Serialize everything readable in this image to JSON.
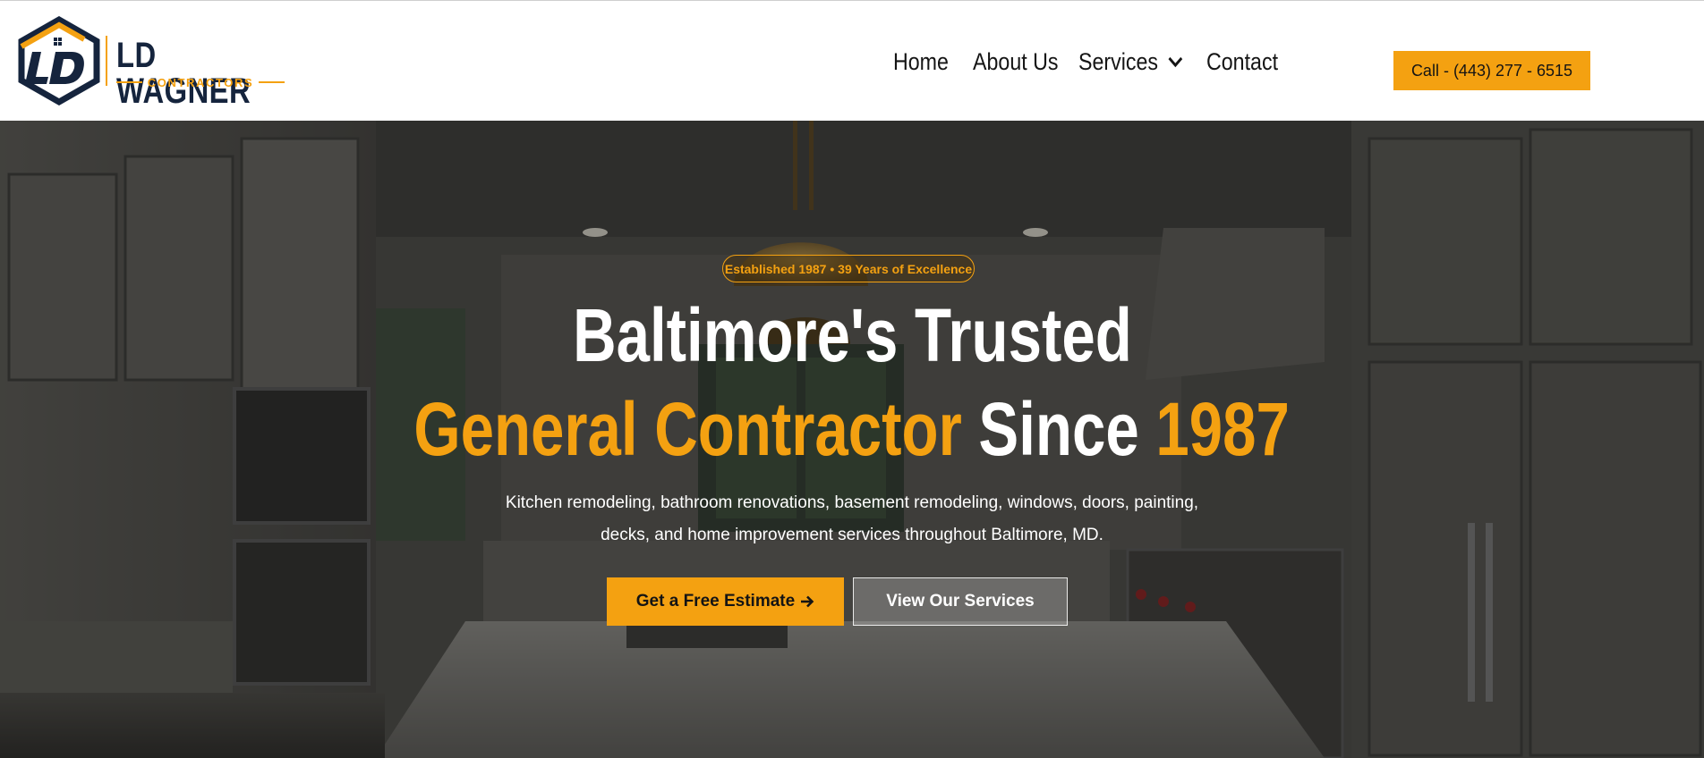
{
  "brand": {
    "name": "LD WAGNER",
    "tagline": "CONTRACTORS",
    "monogram": "LD",
    "colors": {
      "navy": "#15243d",
      "accent": "#f4a111"
    }
  },
  "nav": {
    "items": [
      {
        "label": "Home"
      },
      {
        "label": "About Us"
      },
      {
        "label": "Services",
        "icon": "chevron-down-icon"
      },
      {
        "label": "Contact"
      }
    ]
  },
  "header": {
    "call_label": "Call - (443) 277 - 6515"
  },
  "hero": {
    "badge": "Established 1987 • 39 Years of Excellence",
    "title_line1": "Baltimore's Trusted",
    "title_line2": {
      "part1": "General Contractor",
      "part2": "Since",
      "part3": "1987"
    },
    "subtitle_line1": "Kitchen remodeling, bathroom renovations, basement remodeling, windows, doors, painting,",
    "subtitle_line2": "decks, and home improvement services throughout Baltimore, MD.",
    "cta_primary": "Get a Free Estimate",
    "cta_primary_icon": "arrow-right-icon",
    "cta_secondary": "View Our Services",
    "background": "kitchen-interior-photo"
  }
}
